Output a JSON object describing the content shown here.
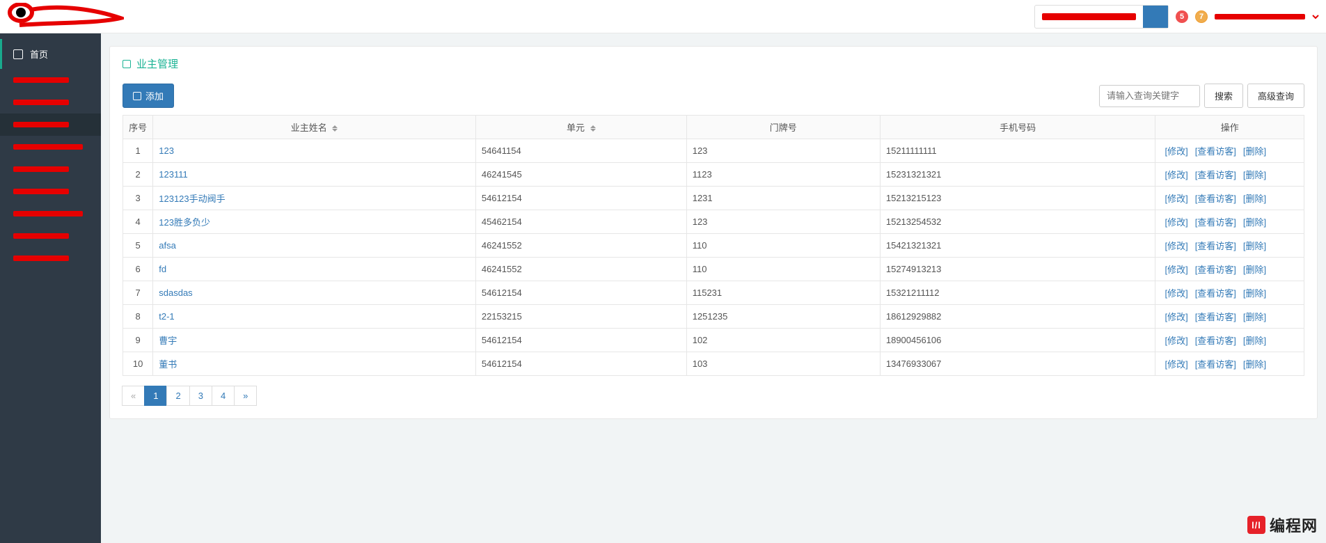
{
  "topbar": {
    "badge5": "5",
    "badge7": "7"
  },
  "sidebar": {
    "home_icon": "home-icon",
    "home_label": "首页"
  },
  "page": {
    "title": "业主管理"
  },
  "toolbar": {
    "add_label": "添加",
    "search_placeholder": "请输入查询关键字",
    "search_btn": "搜索",
    "advanced_btn": "高级查询"
  },
  "table": {
    "headers": {
      "seq": "序号",
      "name": "业主姓名",
      "unit": "单元",
      "door": "门牌号",
      "phone": "手机号码",
      "ops": "操作"
    },
    "ops": {
      "edit": "[修改]",
      "view": "[查看访客]",
      "del": "[删除]"
    },
    "rows": [
      {
        "seq": "1",
        "name": "123",
        "unit": "54641154",
        "door": "123",
        "phone": "15211111111"
      },
      {
        "seq": "2",
        "name": "123111",
        "unit": "46241545",
        "door": "1123",
        "phone": "15231321321"
      },
      {
        "seq": "3",
        "name": "123123手动阀手",
        "unit": "54612154",
        "door": "1231",
        "phone": "15213215123"
      },
      {
        "seq": "4",
        "name": "123胜多负少",
        "unit": "45462154",
        "door": "123",
        "phone": "15213254532"
      },
      {
        "seq": "5",
        "name": "afsa",
        "unit": "46241552",
        "door": "110",
        "phone": "15421321321"
      },
      {
        "seq": "6",
        "name": "fd",
        "unit": "46241552",
        "door": "110",
        "phone": "15274913213"
      },
      {
        "seq": "7",
        "name": "sdasdas",
        "unit": "54612154",
        "door": "115231",
        "phone": "15321211112"
      },
      {
        "seq": "8",
        "name": "t2-1",
        "unit": "22153215",
        "door": "1251235",
        "phone": "18612929882"
      },
      {
        "seq": "9",
        "name": "曹宇",
        "unit": "54612154",
        "door": "102",
        "phone": "18900456106"
      },
      {
        "seq": "10",
        "name": "董书",
        "unit": "54612154",
        "door": "103",
        "phone": "13476933067"
      }
    ]
  },
  "pagination": {
    "prev": "«",
    "pages": [
      "1",
      "2",
      "3",
      "4"
    ],
    "next": "»",
    "active": "1"
  },
  "watermark": {
    "icon_text": "l/l",
    "text": "编程网"
  }
}
